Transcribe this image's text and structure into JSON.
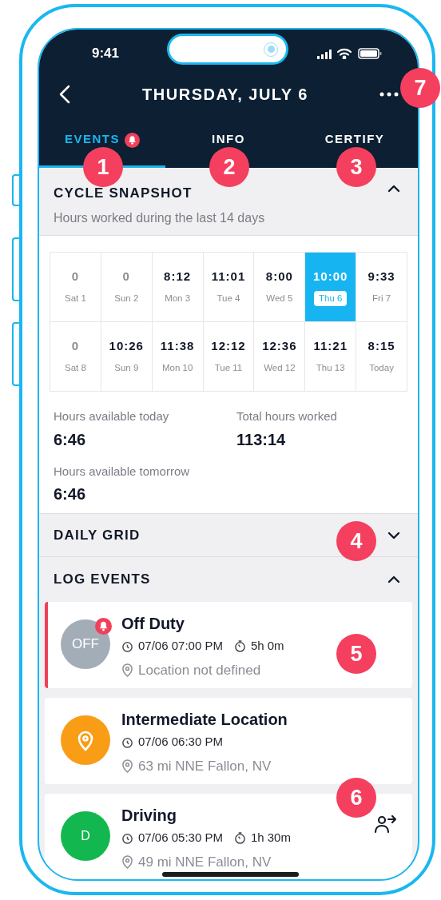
{
  "status_bar": {
    "time": "9:41"
  },
  "header": {
    "title": "THURSDAY, JULY 6"
  },
  "tabs": [
    {
      "label": "EVENTS",
      "selected": true,
      "alert": true
    },
    {
      "label": "INFO",
      "selected": false,
      "alert": false
    },
    {
      "label": "CERTIFY",
      "selected": false,
      "alert": false
    }
  ],
  "cycle_snapshot": {
    "title": "CYCLE SNAPSHOT",
    "subtitle": "Hours worked during the last 14 days",
    "expanded": true,
    "days": [
      {
        "value": "0",
        "day": "Sat 1",
        "muted": true,
        "selected": false
      },
      {
        "value": "0",
        "day": "Sun 2",
        "muted": true,
        "selected": false
      },
      {
        "value": "8:12",
        "day": "Mon 3",
        "muted": false,
        "selected": false
      },
      {
        "value": "11:01",
        "day": "Tue 4",
        "muted": false,
        "selected": false
      },
      {
        "value": "8:00",
        "day": "Wed 5",
        "muted": false,
        "selected": false
      },
      {
        "value": "10:00",
        "day": "Thu 6",
        "muted": false,
        "selected": true
      },
      {
        "value": "9:33",
        "day": "Fri 7",
        "muted": false,
        "selected": false
      },
      {
        "value": "0",
        "day": "Sat 8",
        "muted": true,
        "selected": false
      },
      {
        "value": "10:26",
        "day": "Sun 9",
        "muted": false,
        "selected": false
      },
      {
        "value": "11:38",
        "day": "Mon 10",
        "muted": false,
        "selected": false
      },
      {
        "value": "12:12",
        "day": "Tue 11",
        "muted": false,
        "selected": false
      },
      {
        "value": "12:36",
        "day": "Wed 12",
        "muted": false,
        "selected": false
      },
      {
        "value": "11:21",
        "day": "Thu 13",
        "muted": false,
        "selected": false
      },
      {
        "value": "8:15",
        "day": "Today",
        "muted": false,
        "selected": false
      }
    ],
    "stats": [
      {
        "label": "Hours available today",
        "value": "6:46"
      },
      {
        "label": "Total hours worked",
        "value": "113:14"
      },
      {
        "label": "Hours available tomorrow",
        "value": "6:46"
      }
    ]
  },
  "daily_grid": {
    "title": "DAILY GRID",
    "expanded": false
  },
  "log_events": {
    "title": "LOG EVENTS",
    "expanded": true,
    "events": [
      {
        "title": "Off Duty",
        "avatar": {
          "kind": "text",
          "text": "OFF",
          "color": "#a3adb8"
        },
        "alert": true,
        "time": "07/06 07:00 PM",
        "duration": "5h 0m",
        "location": "Location not defined",
        "action": false
      },
      {
        "title": "Intermediate Location",
        "avatar": {
          "kind": "pin",
          "color": "#f99d16"
        },
        "alert": false,
        "time": "07/06 06:30 PM",
        "location": "63 mi NNE Fallon, NV",
        "action": false
      },
      {
        "title": "Driving",
        "avatar": {
          "kind": "text",
          "text": "D",
          "color": "#12b84f"
        },
        "alert": false,
        "time": "07/06 05:30 PM",
        "duration": "1h 30m",
        "location": "49 mi NNE Fallon, NV",
        "action": true
      }
    ]
  },
  "annotations": [
    {
      "label": "1"
    },
    {
      "label": "2"
    },
    {
      "label": "3"
    },
    {
      "label": "4"
    },
    {
      "label": "5"
    },
    {
      "label": "6"
    },
    {
      "label": "7"
    }
  ]
}
